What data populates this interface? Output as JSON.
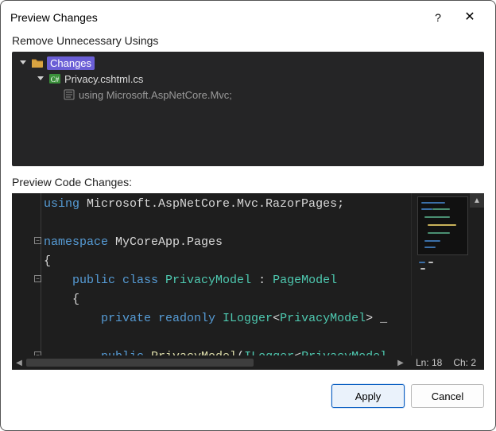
{
  "dialog": {
    "title": "Preview Changes",
    "help_label": "?",
    "close_label": "✕"
  },
  "section_labels": {
    "tree": "Remove Unnecessary Usings",
    "code": "Preview Code Changes:"
  },
  "tree": {
    "root": {
      "label": "Changes"
    },
    "file": {
      "label": "Privacy.cshtml.cs",
      "lang_tag": "C#"
    },
    "removed_using": {
      "label": "using Microsoft.AspNetCore.Mvc;"
    }
  },
  "code": {
    "lines": [
      {
        "tokens": [
          {
            "t": "using ",
            "c": "k-blue"
          },
          {
            "t": "Microsoft.AspNetCore.Mvc.RazorPages;",
            "c": "k-white"
          }
        ]
      },
      {
        "tokens": [
          {
            "t": " ",
            "c": "k-white"
          }
        ]
      },
      {
        "tokens": [
          {
            "t": "namespace ",
            "c": "k-blue"
          },
          {
            "t": "MyCoreApp.Pages",
            "c": "k-white"
          }
        ]
      },
      {
        "tokens": [
          {
            "t": "{",
            "c": "k-white"
          }
        ]
      },
      {
        "tokens": [
          {
            "t": "    ",
            "c": ""
          },
          {
            "t": "public class ",
            "c": "k-blue"
          },
          {
            "t": "PrivacyModel ",
            "c": "k-teal"
          },
          {
            "t": ": ",
            "c": "k-white"
          },
          {
            "t": "PageModel",
            "c": "k-teal"
          }
        ]
      },
      {
        "tokens": [
          {
            "t": "    {",
            "c": "k-white"
          }
        ]
      },
      {
        "tokens": [
          {
            "t": "        ",
            "c": ""
          },
          {
            "t": "private readonly ",
            "c": "k-blue"
          },
          {
            "t": "ILogger",
            "c": "k-teal"
          },
          {
            "t": "<",
            "c": "k-white"
          },
          {
            "t": "PrivacyModel",
            "c": "k-teal"
          },
          {
            "t": "> _",
            "c": "k-white"
          }
        ]
      },
      {
        "tokens": [
          {
            "t": " ",
            "c": "k-white"
          }
        ]
      },
      {
        "tokens": [
          {
            "t": "        ",
            "c": ""
          },
          {
            "t": "public ",
            "c": "k-blue"
          },
          {
            "t": "PrivacyModel",
            "c": "k-yellow"
          },
          {
            "t": "(",
            "c": "k-white"
          },
          {
            "t": "ILogger",
            "c": "k-teal"
          },
          {
            "t": "<",
            "c": "k-white"
          },
          {
            "t": "PrivacyModel",
            "c": "k-teal"
          }
        ]
      },
      {
        "tokens": [
          {
            "t": "        {",
            "c": "k-white"
          }
        ]
      }
    ],
    "status": {
      "line_label": "Ln: 18",
      "col_label": "Ch: 2"
    }
  },
  "buttons": {
    "apply": "Apply",
    "cancel": "Cancel"
  }
}
